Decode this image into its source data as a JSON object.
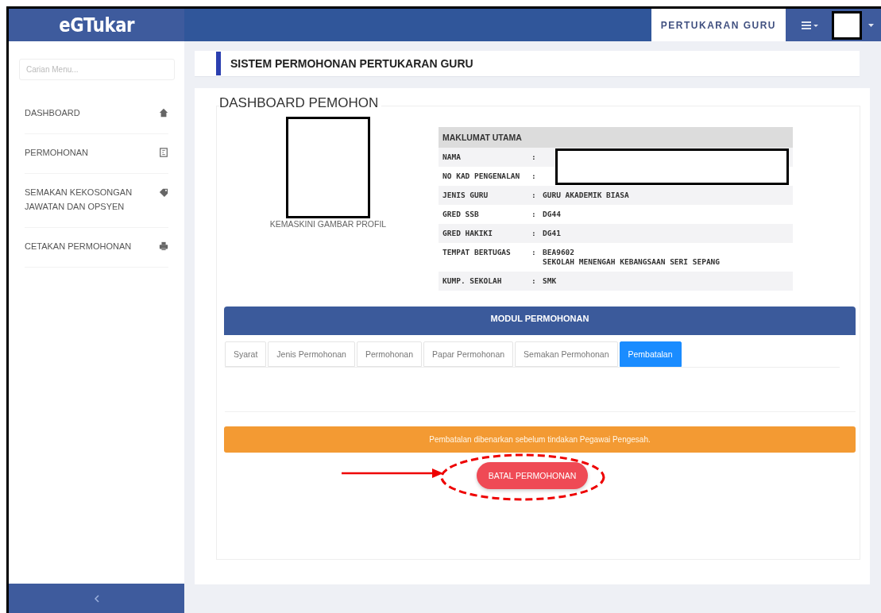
{
  "brand": "eGTukar",
  "header": {
    "module_tab": "PERTUKARAN GURU"
  },
  "sidebar": {
    "search": {
      "placeholder": "Carian Menu..."
    },
    "items": [
      {
        "label": "DASHBOARD",
        "kind": "home"
      },
      {
        "label": "PERMOHONAN",
        "kind": "form"
      },
      {
        "label": "SEMAKAN KEKOSONGAN JAWATAN DAN OPSYEN",
        "kind": "tag"
      },
      {
        "label": "CETAKAN PERMOHONAN",
        "kind": "print"
      }
    ]
  },
  "page_title": "SISTEM PERMOHONAN PERTUKARAN GURU",
  "dashboard": {
    "title": "DASHBOARD PEMOHON",
    "profile_link": "KEMASKINI GAMBAR PROFIL",
    "info": {
      "heading": "MAKLUMAT UTAMA",
      "rows": [
        {
          "label": "NAMA",
          "separator": ":",
          "value": []
        },
        {
          "label": "NO KAD PENGENALAN",
          "separator": ":",
          "value": []
        },
        {
          "label": "JENIS GURU",
          "separator": ":",
          "value": [
            "GURU AKADEMIK BIASA"
          ]
        },
        {
          "label": "GRED SSB",
          "separator": ":",
          "value": [
            "DG44"
          ]
        },
        {
          "label": "GRED HAKIKI",
          "separator": ":",
          "value": [
            "DG41"
          ]
        },
        {
          "label": "TEMPAT BERTUGAS",
          "separator": ":",
          "value": [
            "BEA9602",
            "SEKOLAH MENENGAH KEBANGSAAN SERI SEPANG"
          ]
        },
        {
          "label": "KUMP. SEKOLAH",
          "separator": ":",
          "value": [
            "SMK"
          ]
        }
      ]
    }
  },
  "module": {
    "title": "MODUL PERMOHONAN",
    "tabs": [
      {
        "label": "Syarat",
        "selected": false
      },
      {
        "label": "Jenis Permohonan",
        "selected": false
      },
      {
        "label": "Permohonan",
        "selected": false
      },
      {
        "label": "Papar Permohonan",
        "selected": false
      },
      {
        "label": "Semakan Permohonan",
        "selected": false
      },
      {
        "label": "Pembatalan",
        "selected": true
      }
    ],
    "alert": "Pembatalan dibenarkan sebelum tindakan Pegawai Pengesah.",
    "button": "BATAL PERMOHONAN"
  }
}
